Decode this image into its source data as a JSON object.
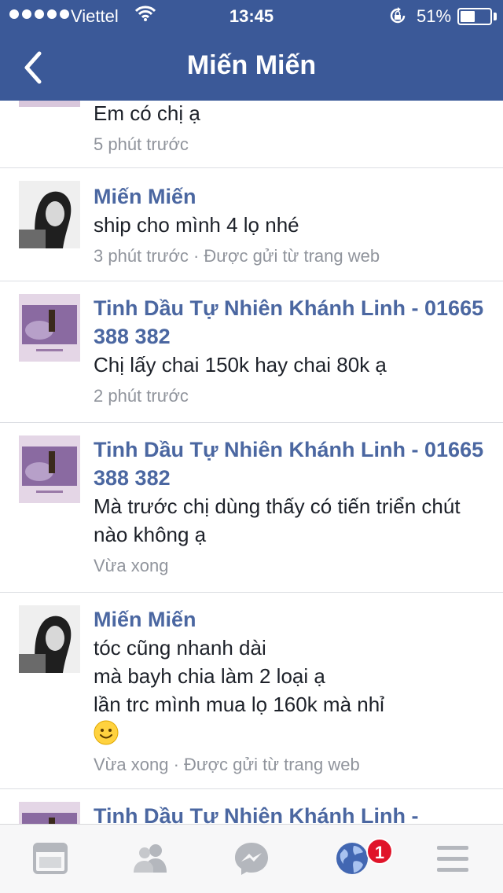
{
  "status_bar": {
    "carrier": "Viettel",
    "time": "13:45",
    "battery_percent_label": "51%",
    "battery_level": 0.51,
    "icons": [
      "signal-dots",
      "wifi-icon",
      "rotation-lock-icon",
      "battery-icon"
    ]
  },
  "nav": {
    "title": "Miến Miến",
    "back_icon": "chevron-left-icon"
  },
  "comments": [
    {
      "kind": "page",
      "author": "",
      "body": [
        "Em có chị ạ"
      ],
      "meta": "5 phút trước"
    },
    {
      "kind": "user",
      "author": "Miến Miến",
      "body": [
        "ship cho mình 4 lọ nhé"
      ],
      "meta": "3 phút trước · Được gửi từ trang web"
    },
    {
      "kind": "page",
      "author": "Tinh Dầu Tự Nhiên Khánh Linh - 01665 388 382",
      "body": [
        "Chị lấy chai 150k hay chai 80k ạ"
      ],
      "meta": "2 phút trước"
    },
    {
      "kind": "page",
      "author": "Tinh Dầu Tự Nhiên Khánh Linh - 01665 388 382",
      "body": [
        "Mà trước chị dùng thấy có tiến triển chút nào không ạ"
      ],
      "meta": "Vừa xong"
    },
    {
      "kind": "user",
      "author": "Miến Miến",
      "body": [
        "tóc cũng nhanh dài",
        "mà bayh chia làm 2 loại ạ",
        "lần trc mình mua lọ 160k mà nhỉ"
      ],
      "emoji": "smile-emoji-icon",
      "meta": "Vừa xong · Được gửi từ trang web"
    },
    {
      "kind": "page",
      "author": "Tinh Dầu Tự Nhiên Khánh Linh -",
      "body": [],
      "meta": ""
    }
  ],
  "tabbar": {
    "tabs": [
      "news-feed-icon",
      "friends-icon",
      "messenger-icon",
      "notifications-globe-icon",
      "menu-icon"
    ],
    "notification_badge": "1",
    "colors": {
      "inactive": "#b4b7bd",
      "active": "#4267b2",
      "badge": "#e0142a"
    }
  },
  "colors": {
    "header": "#3b5998",
    "author": "#4b67a1",
    "meta": "#90949c",
    "divider": "#dcdee3"
  }
}
